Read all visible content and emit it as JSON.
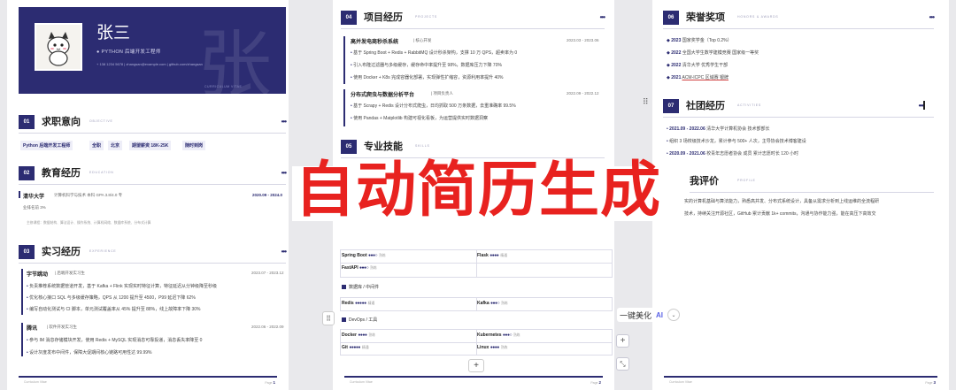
{
  "header": {
    "name": "张三",
    "role": "● PYTHON 后端开发工程师",
    "contact": "+ 138 1234 5678   |   zhangsan@example.com   |   github.com/zhangsan",
    "big_char": "张",
    "foot": "CURRICULUM VITAE"
  },
  "p1": {
    "s1": {
      "num": "01",
      "title": "求职意向",
      "en": "OBJECTIVE",
      "tags": [
        "Python 后端开发工程师",
        "全职",
        "北京",
        "期望薪资 18K-25K",
        "随时到岗"
      ]
    },
    "s2": {
      "num": "02",
      "title": "教育经历",
      "en": "EDUCATION",
      "school": "清华大学",
      "detail": "计算机科学与技术  本科  GPA 3.8/4.0  专",
      "detail2": "业排名前 3%",
      "date": "2020.09 - 2024.0",
      "courses": "主修课程：数据结构、算法设计、操作系统、计算机网络、数据库系统、分布式计算"
    },
    "s3": {
      "num": "03",
      "title": "实习经历",
      "en": "EXPERIENCE",
      "jobs": [
        {
          "company": "字节跳动",
          "role": "后端开发实习生",
          "date": "2023.07 - 2023.12",
          "items": [
            "负责推荐系统数据管道开发，基于 Kafka + Flink 实现实时特征计算，特征延迟从分钟级降至秒级",
            "优化核心接口 SQL 与多级缓存策略，QPS 从 1200 提升至 4500，P99 延迟下降 62%",
            "编写自动化测试与 CI 脚本，单元测试覆盖率从 45% 提升至 88%，线上故障率下降 30%"
          ]
        },
        {
          "company": "腾讯",
          "role": "软件开发实习生",
          "date": "2022.06 - 2022.09",
          "items": [
            "参与 IM 消息存储模块开发，使用 Redis + MySQL 实现消息可靠投递，消息丢失率降至 0",
            "设计灰度发布中间件，保障大促期间核心链路可用性达 99.99%"
          ]
        }
      ]
    },
    "footer_l": "Curriculum Vitae",
    "footer_page": "1"
  },
  "p2": {
    "s4": {
      "num": "04",
      "title": "项目经历",
      "en": "PROJECTS",
      "projects": [
        {
          "name": "高并发电商秒杀系统",
          "role": "核心开发",
          "date": "2023.03 - 2023.06",
          "items": [
            "基于 Spring Boot + Redis + RabbitMQ 设计秒杀架构，支撑 10 万 QPS，超卖率为 0",
            "引入布隆过滤器与多级缓存，缓存命中率提升至 98%，数据库压力下降 70%",
            "使用 Docker + K8s 完成容器化部署，实现弹性扩缩容，资源利用率提升 40%"
          ]
        },
        {
          "name": "分布式爬虫与数据分析平台",
          "role": "项目负责人",
          "date": "2022.09 - 2022.12",
          "items": [
            "基于 Scrapy + Redis 设计分布式爬虫，日均抓取 500 万条数据，去重准确率 99.5%",
            "使用 Pandas + Matplotlib 构建可视化看板，为运营提供实时数据洞察"
          ]
        }
      ]
    },
    "s5": {
      "num": "05",
      "title": "专业技能",
      "en": "SKILLS"
    },
    "skills": {
      "r1": [
        {
          "name": "Spring Boot",
          "dots": "●●●○",
          "lv": "熟练"
        },
        {
          "name": "Flask",
          "dots": "●●●●",
          "lv": "精通"
        }
      ],
      "r2": [
        {
          "name": "FastAPI",
          "dots": "●●●○",
          "lv": "熟练"
        }
      ],
      "cat2": "数据库 / 中间件",
      "r3": [
        {
          "name": "Redis",
          "dots": "●●●●●",
          "lv": "精通"
        },
        {
          "name": "Kafka",
          "dots": "●●●○",
          "lv": "熟练"
        }
      ],
      "cat3": "DevOps / 工具",
      "r4": [
        {
          "name": "Docker",
          "dots": "●●●●",
          "lv": "熟练"
        },
        {
          "name": "Kubernetes",
          "dots": "●●●○",
          "lv": "熟练"
        }
      ],
      "r5": [
        {
          "name": "Git",
          "dots": "●●●●●",
          "lv": "精通"
        },
        {
          "name": "Linux",
          "dots": "●●●●",
          "lv": "熟练"
        }
      ]
    },
    "footer_l": "Curriculum Vitae",
    "footer_page": "2"
  },
  "p3": {
    "s6": {
      "num": "06",
      "title": "荣誉奖项",
      "en": "HONORS & AWARDS",
      "items": [
        {
          "year": "2023",
          "text": "国家奖学金（Top 0.2%）"
        },
        {
          "year": "2022",
          "text": "全国大学生数学建模竞赛 国家级一等奖"
        },
        {
          "year": "2022",
          "text": "清华大学 优秀学生干部"
        },
        {
          "year": "2021",
          "text": "ACM-ICPC 区域赛 银牌"
        }
      ]
    },
    "s7": {
      "num": "07",
      "title": "社团经历",
      "en": "ACTIVITIES",
      "items": [
        {
          "date": "2021.09 - 2022.06",
          "text": "清华大学计算机协会  技术部部长"
        },
        {
          "date": "",
          "text": "组织 3 场校级技术沙龙，累计参与 500+ 人次，主导协会技术博客建设"
        },
        {
          "date": "2020.09 - 2021.06",
          "text": "校青年志愿者协会  成员  累计志愿时长 120 小时"
        }
      ]
    },
    "s8": {
      "title": "我评价",
      "en": "PROFILE",
      "line1": "实的计算机基础与算法能力，熟悉高并发、分布式系统设计，具备从需求分析到上线运维的全流程研",
      "line2": "技术，持续关注开源社区，GitHub 累计贡献 1k+ commits，沟通与协作能力强，能在高压下高效交"
    },
    "footer_l": "Curriculum Vitae",
    "footer_page": "3"
  },
  "overlay": {
    "title": "自动简历生成"
  },
  "toolbar": {
    "beautify": "一键美化",
    "ai": "AI",
    "chev": "⌄",
    "plus": "+",
    "drag": "⠿"
  },
  "colors": {
    "accent": "#2c2c72",
    "overlay_red": "#e8221f"
  }
}
